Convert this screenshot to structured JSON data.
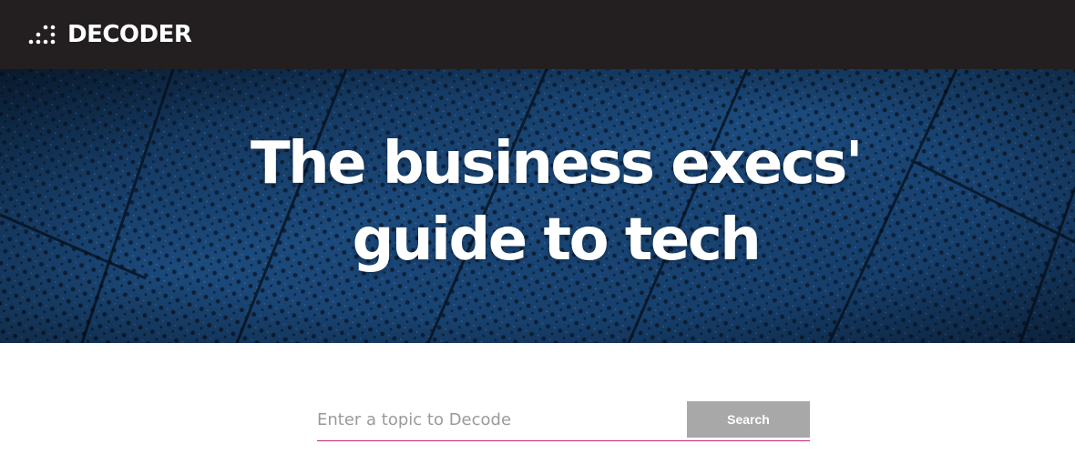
{
  "header": {
    "logo_text": "DECODER",
    "logo_icon": "dots-icon",
    "background_color": "#231f20"
  },
  "hero": {
    "title_line1": "The business execs'",
    "title_line2": "guide to tech",
    "background_color": "#163a63"
  },
  "search": {
    "placeholder": "Enter a topic to Decode",
    "value": "",
    "button_label": "Search",
    "button_color": "#a8a8a8",
    "underline_color": "#c0297c"
  }
}
